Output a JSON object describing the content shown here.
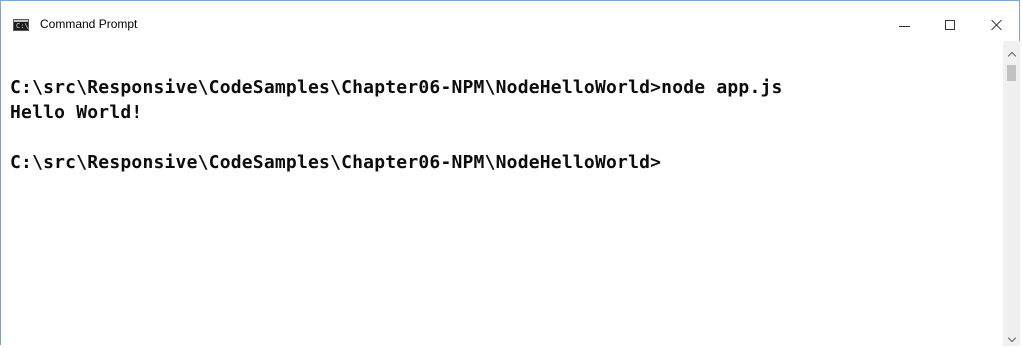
{
  "window": {
    "title": "Command Prompt",
    "icon": "command-prompt-icon",
    "controls": {
      "minimize": "minimize-icon",
      "maximize": "maximize-icon",
      "close": "close-icon"
    }
  },
  "console": {
    "lines": [
      "C:\\src\\Responsive\\CodeSamples\\Chapter06-NPM\\NodeHelloWorld>node app.js",
      "Hello World!",
      "C:\\src\\Responsive\\CodeSamples\\Chapter06-NPM\\NodeHelloWorld>"
    ]
  },
  "colors": {
    "window_border": "#7aa7d6",
    "console_background": "#ffffff",
    "console_text": "#0c0c0c",
    "scrollbar_track": "#f0f0f0",
    "scrollbar_thumb": "#c2c2c2"
  }
}
